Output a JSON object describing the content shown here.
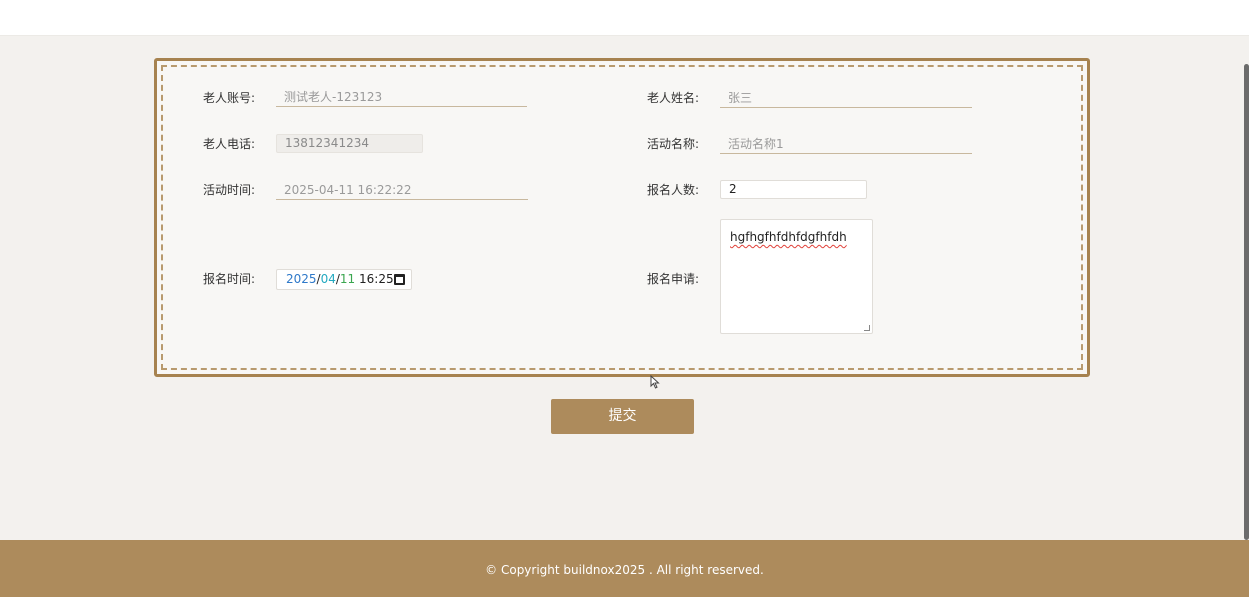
{
  "form": {
    "elder_account_label": "老人账号:",
    "elder_account_value": "测试老人-123123",
    "elder_name_label": "老人姓名:",
    "elder_name_value": "张三",
    "elder_phone_label": "老人电话:",
    "elder_phone_value": "13812341234",
    "activity_name_label": "活动名称:",
    "activity_name_value": "活动名称1",
    "activity_time_label": "活动时间:",
    "activity_time_value": "2025-04-11 16:22:22",
    "signup_count_label": "报名人数:",
    "signup_count_value": "2",
    "signup_time_label": "报名时间:",
    "signup_time_year": "2025",
    "signup_time_month": "04",
    "signup_time_day": "11",
    "signup_time_clock": "16:25",
    "signup_apply_label": "报名申请:",
    "signup_apply_value": "hgfhgfhfdhfdgfhfdh"
  },
  "actions": {
    "submit_label": "提交"
  },
  "footer": {
    "copyright": "© Copyright buildnox2025 . All right reserved."
  },
  "colors": {
    "accent": "#ad8b5c",
    "card_border": "#a6824f"
  },
  "icons": {
    "calendar": "calendar-icon",
    "cursor": "mouse-cursor-icon"
  }
}
